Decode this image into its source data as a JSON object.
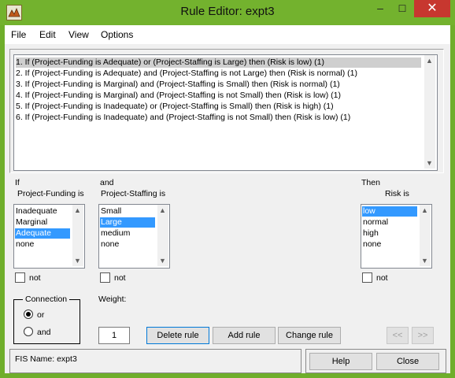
{
  "window": {
    "title": "Rule Editor: expt3",
    "controls": {
      "minimize": "–",
      "maximize": "☐",
      "close": "✕"
    }
  },
  "menu": [
    "File",
    "Edit",
    "View",
    "Options"
  ],
  "rules": [
    "1. If (Project-Funding is Adequate) or (Project-Staffing is Large) then (Risk is low) (1)",
    "2. If (Project-Funding is Adequate) and (Project-Staffing is not Large) then (Risk is normal) (1)",
    "3. If (Project-Funding is Marginal) and (Project-Staffing is Small) then (Risk is normal) (1)",
    "4. If (Project-Funding is Marginal) and (Project-Staffing is not Small) then (Risk is low) (1)",
    "5. If (Project-Funding is Inadequate) or (Project-Staffing is Small) then (Risk is high) (1)",
    "6. If (Project-Funding is Inadequate) and (Project-Staffing is not Small) then (Risk is low) (1)"
  ],
  "selected_rule": 1,
  "antecedents": {
    "if_label": "If",
    "funding_label": "Project-Funding is",
    "funding_items": [
      "Inadequate",
      "Marginal",
      "Adequate",
      "none"
    ],
    "funding_selected": "Adequate",
    "and_label": "and",
    "staffing_label": "Project-Staffing is",
    "staffing_items": [
      "Small",
      "Large",
      "medium",
      "none"
    ],
    "staffing_selected": "Large"
  },
  "consequent": {
    "then_label": "Then",
    "risk_label": "Risk is",
    "risk_items": [
      "low",
      "normal",
      "high",
      "none"
    ],
    "risk_selected": "low"
  },
  "not_label": "not",
  "connection": {
    "label": "Connection",
    "options": [
      "or",
      "and"
    ],
    "selected": "or"
  },
  "weight": {
    "label": "Weight:",
    "value": "1"
  },
  "buttons": {
    "delete_rule": "Delete rule",
    "add_rule": "Add rule",
    "change_rule": "Change rule",
    "prev": "<<",
    "next": ">>",
    "help": "Help",
    "close": "Close"
  },
  "status": "FIS Name: expt3"
}
